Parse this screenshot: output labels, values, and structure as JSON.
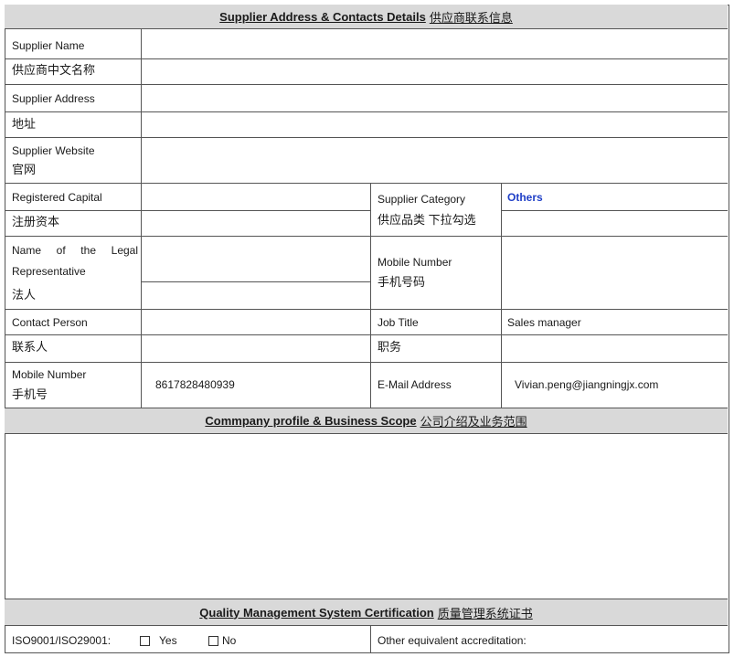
{
  "section1": {
    "title_en": "Supplier Address & Contacts Details",
    "title_cn": "供应商联系信息"
  },
  "rows": {
    "supplier_name_en": "Supplier Name",
    "supplier_name_cn": "供应商中文名称",
    "supplier_address_en": "Supplier Address",
    "supplier_address_cn": "地址",
    "supplier_website_en": "Supplier Website",
    "supplier_website_cn": "官网",
    "registered_capital_en": "Registered Capital",
    "registered_capital_cn": "注册资本",
    "supplier_category_en": "Supplier Category",
    "supplier_category_cn": "供应品类 下拉勾选",
    "supplier_category_value": "Others",
    "legal_rep_en_1": "Name    of    the    Legal",
    "legal_rep_en_2": "Representative",
    "legal_rep_cn": "法人",
    "mobile_number_en": "Mobile Number",
    "mobile_number_cn": "手机号码",
    "contact_person_en": "Contact Person",
    "contact_person_cn": "联系人",
    "job_title_en": "Job Title",
    "job_title_cn": "职务",
    "job_title_value": "Sales manager",
    "mobile_en": "Mobile Number",
    "mobile_cn": "手机号",
    "mobile_value": "8617828480939",
    "email_label": "E-Mail Address",
    "email_value": "Vivian.peng@jiangningjx.com"
  },
  "section2": {
    "title_en": "Commpany profile & Business Scope",
    "title_cn": "公司介绍及业务范围"
  },
  "section3": {
    "title_en": "Quality Management System Certification",
    "title_cn": "质量管理系统证书"
  },
  "iso": {
    "label": "ISO9001/ISO29001:",
    "yes": "Yes",
    "no": "No",
    "other": "Other equivalent accreditation:"
  }
}
